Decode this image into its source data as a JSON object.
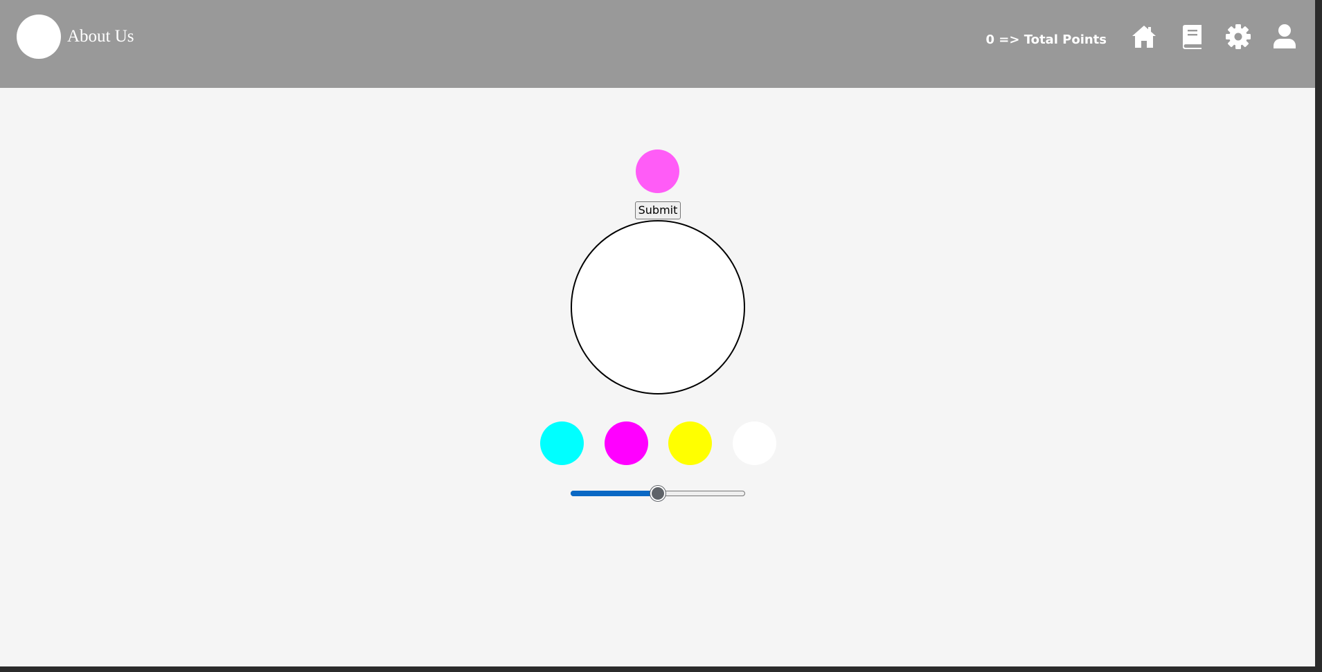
{
  "header": {
    "about_label": "About Us",
    "points_label": "0 => Total Points",
    "icons": {
      "home": "home-icon",
      "book": "book-icon",
      "settings": "gear-icon",
      "profile": "user-icon"
    }
  },
  "game": {
    "target_color": "#ff5cf7",
    "submit_label": "Submit",
    "mix_color": "#ffffff",
    "palette": [
      {
        "name": "cyan",
        "color": "#00ffff"
      },
      {
        "name": "magenta",
        "color": "#ff00ff"
      },
      {
        "name": "yellow",
        "color": "#ffff00"
      },
      {
        "name": "white",
        "color": "#ffffff"
      }
    ],
    "slider": {
      "value": 50,
      "min": 0,
      "max": 100,
      "fill_color": "#0a68c4"
    }
  },
  "colors": {
    "header_bg": "#999999",
    "page_bg": "#f5f5f5"
  }
}
